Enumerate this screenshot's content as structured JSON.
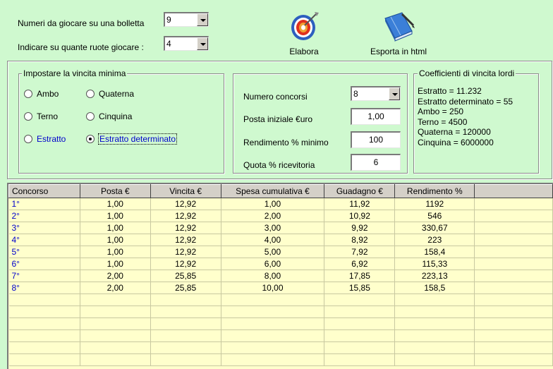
{
  "top": {
    "numeri_label": "Numeri da giocare su una bolletta",
    "numeri_value": "9",
    "ruote_label": "Indicare su quante ruote giocare :",
    "ruote_value": "4"
  },
  "toolbar": {
    "elabora_label": "Elabora",
    "esporta_label": "Esporta in html"
  },
  "vincita": {
    "title": "Impostare la vincita minima",
    "options": [
      "Ambo",
      "Quaterna",
      "Terno",
      "Cinquina",
      "Estratto",
      "Estratto determinato"
    ],
    "selected": "Estratto determinato"
  },
  "params": {
    "concorsi_label": "Numero concorsi",
    "concorsi_value": "8",
    "posta_label": "Posta iniziale €uro",
    "posta_value": "1,00",
    "rendimento_label": "Rendimento % minimo",
    "rendimento_value": "100",
    "quota_label": "Quota % ricevitoria",
    "quota_value": "6"
  },
  "coefficienti": {
    "title": "Coefficienti di vincita lordi",
    "lines": [
      "Estratto =  11.232",
      "Estratto determinato =  55",
      "Ambo =  250",
      "Terno =  4500",
      "Quaterna =  120000",
      "Cinquina =  6000000"
    ]
  },
  "grid": {
    "headers": [
      "Concorso",
      "Posta €",
      "Vincita €",
      "Spesa cumulativa €",
      "Guadagno €",
      "Rendimento %",
      ""
    ],
    "rows": [
      [
        "1°",
        "1,00",
        "12,92",
        "1,00",
        "11,92",
        "1192",
        ""
      ],
      [
        "2°",
        "1,00",
        "12,92",
        "2,00",
        "10,92",
        "546",
        ""
      ],
      [
        "3°",
        "1,00",
        "12,92",
        "3,00",
        "9,92",
        "330,67",
        ""
      ],
      [
        "4°",
        "1,00",
        "12,92",
        "4,00",
        "8,92",
        "223",
        ""
      ],
      [
        "5°",
        "1,00",
        "12,92",
        "5,00",
        "7,92",
        "158,4",
        ""
      ],
      [
        "6°",
        "1,00",
        "12,92",
        "6,00",
        "6,92",
        "115,33",
        ""
      ],
      [
        "7°",
        "2,00",
        "25,85",
        "8,00",
        "17,85",
        "223,13",
        ""
      ],
      [
        "8°",
        "2,00",
        "25,85",
        "10,00",
        "15,85",
        "158,5",
        ""
      ]
    ],
    "empty_rows": 6
  },
  "colors": {
    "background": "#cff9cf",
    "grid_background": "#ffffcc",
    "accent_text": "#0000cc"
  },
  "icons": {
    "elabora": "target-dart-icon",
    "esporta": "book-pen-icon"
  }
}
